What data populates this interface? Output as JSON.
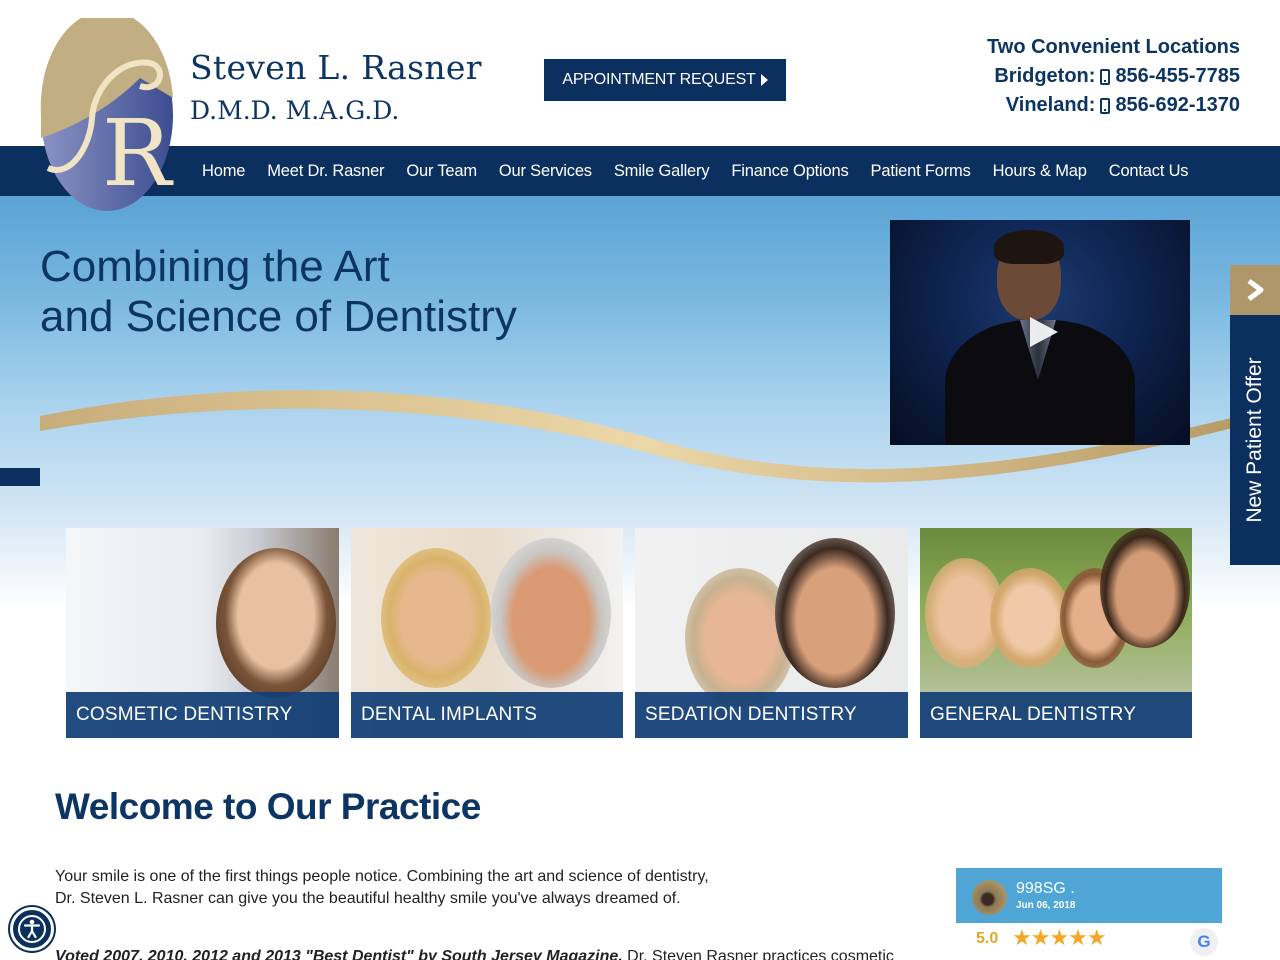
{
  "header": {
    "logo_alt": "SR monogram",
    "name": "Steven L. Rasner",
    "credentials": "D.M.D. M.A.G.D.",
    "appointment_button": "APPOINTMENT REQUEST",
    "locations": {
      "title": "Two Convenient Locations",
      "items": [
        {
          "city": "Bridgeton:",
          "phone": "856-455-7785"
        },
        {
          "city": "Vineland:",
          "phone": "856-692-1370"
        }
      ]
    }
  },
  "nav": {
    "items": [
      {
        "label": "Home"
      },
      {
        "label": "Meet Dr. Rasner"
      },
      {
        "label": "Our Team"
      },
      {
        "label": "Our Services"
      },
      {
        "label": "Smile Gallery"
      },
      {
        "label": "Finance Options"
      },
      {
        "label": "Patient Forms"
      },
      {
        "label": "Hours & Map"
      },
      {
        "label": "Contact Us"
      }
    ]
  },
  "hero": {
    "title_line1": "Combining the Art",
    "title_line2": "and Science of Dentistry",
    "video_icon": "play-icon"
  },
  "side_tab": {
    "label": "New Patient Offer",
    "icon": "chevron-right-icon"
  },
  "services": [
    {
      "label": "COSMETIC DENTISTRY"
    },
    {
      "label": "DENTAL IMPLANTS"
    },
    {
      "label": "SEDATION DENTISTRY"
    },
    {
      "label": "GENERAL DENTISTRY"
    }
  ],
  "welcome": {
    "title": "Welcome to Our Practice",
    "intro_line1": "Your smile is one of the first things people notice.  Combining the art and science of dentistry,",
    "intro_line2": "Dr. Steven L. Rasner can give you the beautiful healthy smile you've always dreamed of.",
    "voted_bold": "Voted 2007, 2010, 2012 and 2013 \"Best Dentist\" by South Jersey Magazine.",
    "voted_rest": " Dr. Steven Rasner practices cosmetic"
  },
  "review": {
    "reviewer": "998SG .",
    "date": "Jun 06, 2018",
    "rating_text": "5.0",
    "rating": 5,
    "stars": "★★★★★",
    "source_icon": "G"
  },
  "colors": {
    "navy": "#0b2f5e",
    "gold": "#b0976b",
    "review_blue": "#4ea5d6",
    "star": "#f6a623"
  }
}
